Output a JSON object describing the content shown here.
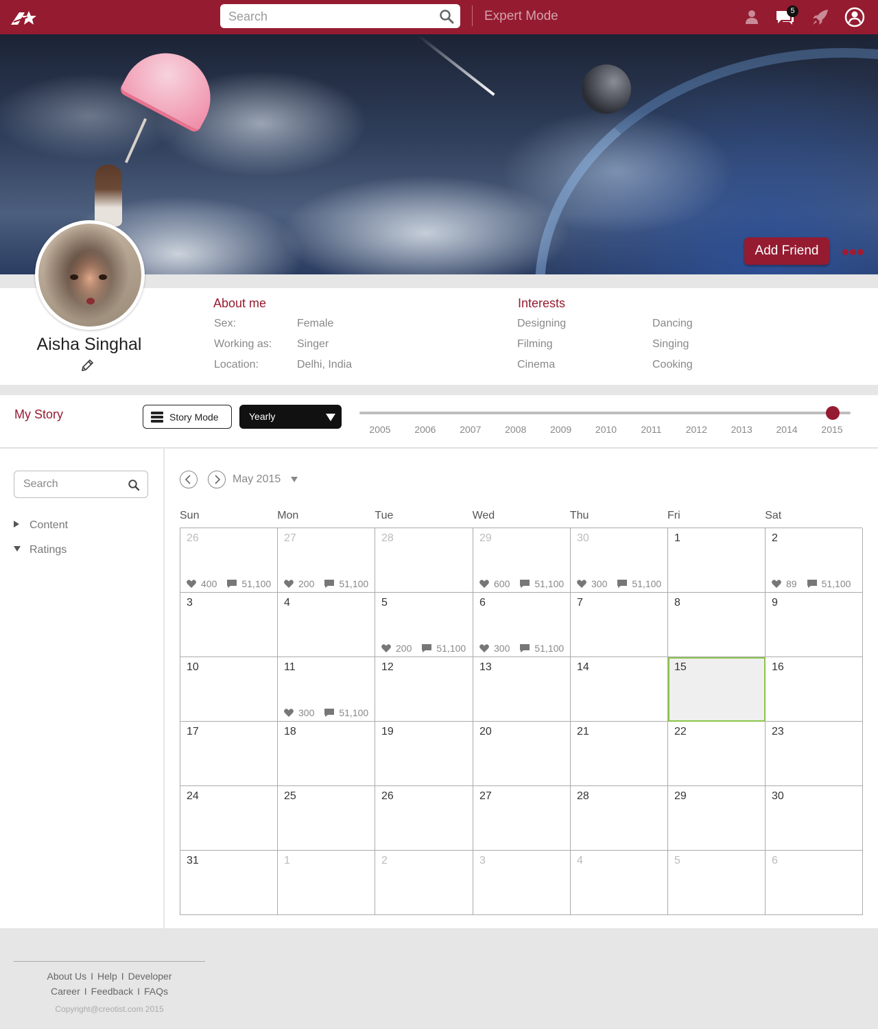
{
  "topbar": {
    "search_placeholder": "Search",
    "expert_mode": "Expert Mode",
    "notifications_count": "5",
    "icons": [
      "logo-icon",
      "search-icon",
      "person-icon",
      "chat-icon",
      "rocket-icon",
      "account-icon"
    ],
    "brand_color": "#951b31"
  },
  "banner": {
    "add_friend": "Add Friend"
  },
  "profile": {
    "name": "Aisha Singhal",
    "about_title": "About me",
    "about": [
      {
        "label": "Sex:",
        "value": "Female"
      },
      {
        "label": "Working as:",
        "value": "Singer"
      },
      {
        "label": "Location:",
        "value": "Delhi, India"
      }
    ],
    "interests_title": "Interests",
    "interests": [
      "Designing",
      "Dancing",
      "Filming",
      "Singing",
      "Cinema",
      "Cooking"
    ]
  },
  "story": {
    "title": "My Story",
    "mode_button": "Story Mode",
    "period": "Yearly",
    "years": [
      "2005",
      "2006",
      "2007",
      "2008",
      "2009",
      "2010",
      "2011",
      "2012",
      "2013",
      "2014",
      "2015"
    ],
    "selected_year": "2015"
  },
  "sidebar": {
    "search_placeholder": "Search",
    "items": [
      {
        "label": "Content",
        "expanded": false
      },
      {
        "label": "Ratings",
        "expanded": true
      }
    ]
  },
  "calendar": {
    "month": "May 2015",
    "weekdays": [
      "Sun",
      "Mon",
      "Tue",
      "Wed",
      "Thu",
      "Fri",
      "Sat"
    ],
    "today": "15",
    "today_color": "#8bc34a",
    "weeks": [
      [
        {
          "day": "26",
          "other": true,
          "likes": "400",
          "comments": "51,100"
        },
        {
          "day": "27",
          "other": true,
          "likes": "200",
          "comments": "51,100"
        },
        {
          "day": "28",
          "other": true
        },
        {
          "day": "29",
          "other": true,
          "likes": "600",
          "comments": "51,100"
        },
        {
          "day": "30",
          "other": true,
          "likes": "300",
          "comments": "51,100"
        },
        {
          "day": "1"
        },
        {
          "day": "2",
          "likes": "89",
          "comments": "51,100"
        }
      ],
      [
        {
          "day": "3"
        },
        {
          "day": "4"
        },
        {
          "day": "5",
          "likes": "200",
          "comments": "51,100"
        },
        {
          "day": "6",
          "likes": "300",
          "comments": "51,100"
        },
        {
          "day": "7"
        },
        {
          "day": "8"
        },
        {
          "day": "9"
        }
      ],
      [
        {
          "day": "10"
        },
        {
          "day": "11",
          "likes": "300",
          "comments": "51,100"
        },
        {
          "day": "12"
        },
        {
          "day": "13"
        },
        {
          "day": "14"
        },
        {
          "day": "15",
          "today": true
        },
        {
          "day": "16"
        }
      ],
      [
        {
          "day": "17"
        },
        {
          "day": "18"
        },
        {
          "day": "19"
        },
        {
          "day": "20"
        },
        {
          "day": "21"
        },
        {
          "day": "22"
        },
        {
          "day": "23"
        }
      ],
      [
        {
          "day": "24"
        },
        {
          "day": "25"
        },
        {
          "day": "26"
        },
        {
          "day": "27"
        },
        {
          "day": "28"
        },
        {
          "day": "29"
        },
        {
          "day": "30"
        }
      ],
      [
        {
          "day": "31"
        },
        {
          "day": "1",
          "other": true
        },
        {
          "day": "2",
          "other": true
        },
        {
          "day": "3",
          "other": true
        },
        {
          "day": "4",
          "other": true
        },
        {
          "day": "5",
          "other": true
        },
        {
          "day": "6",
          "other": true
        }
      ]
    ]
  },
  "footer": {
    "row1": [
      "About Us",
      "Help",
      "Developer"
    ],
    "row2": [
      "Career",
      "Feedback",
      "FAQs"
    ],
    "copyright": "Copyright@creotist.com 2015"
  }
}
